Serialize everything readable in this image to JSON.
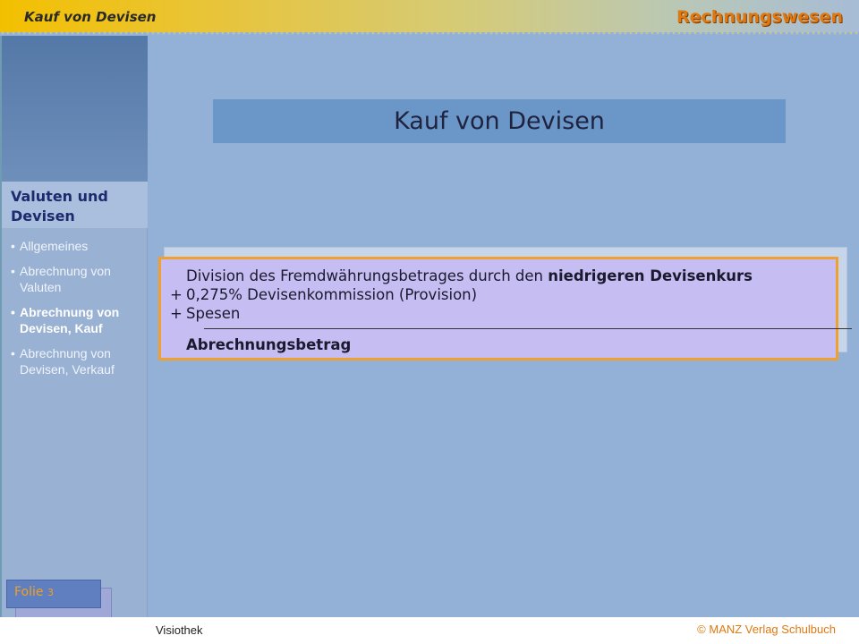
{
  "header": {
    "section_title": "Kauf von Devisen",
    "brand": "Rechnungswesen"
  },
  "sidebar": {
    "heading_line1": "Valuten und",
    "heading_line2": "Devisen",
    "items": [
      {
        "label": "Allgemeines",
        "active": false
      },
      {
        "label": "Abrechnung von Valuten",
        "active": false
      },
      {
        "label": "Abrechnung von Devisen, Kauf",
        "active": true
      },
      {
        "label": "Abrechnung von Devisen, Verkauf",
        "active": false
      }
    ]
  },
  "slide": {
    "label": "Folie",
    "number": "3"
  },
  "main": {
    "title": "Kauf von Devisen",
    "formula": {
      "line1_text": "Division des Fremdwährungsbetrages durch den",
      "line1_bold": "niedrigeren Devisenkurs",
      "line2_op": "+",
      "line2_text": "0,275% Devisenkommission (Provision)",
      "line3_op": "+",
      "line3_text": "Spesen",
      "result": "Abrechnungsbetrag"
    }
  },
  "footer": {
    "left": "Visiothek",
    "right": "© MANZ Verlag Schulbuch"
  },
  "colors": {
    "accent_orange": "#e07810",
    "card_border": "#f0a030",
    "card_bg": "#c6bdf3",
    "title_bg": "#6b96c8"
  }
}
